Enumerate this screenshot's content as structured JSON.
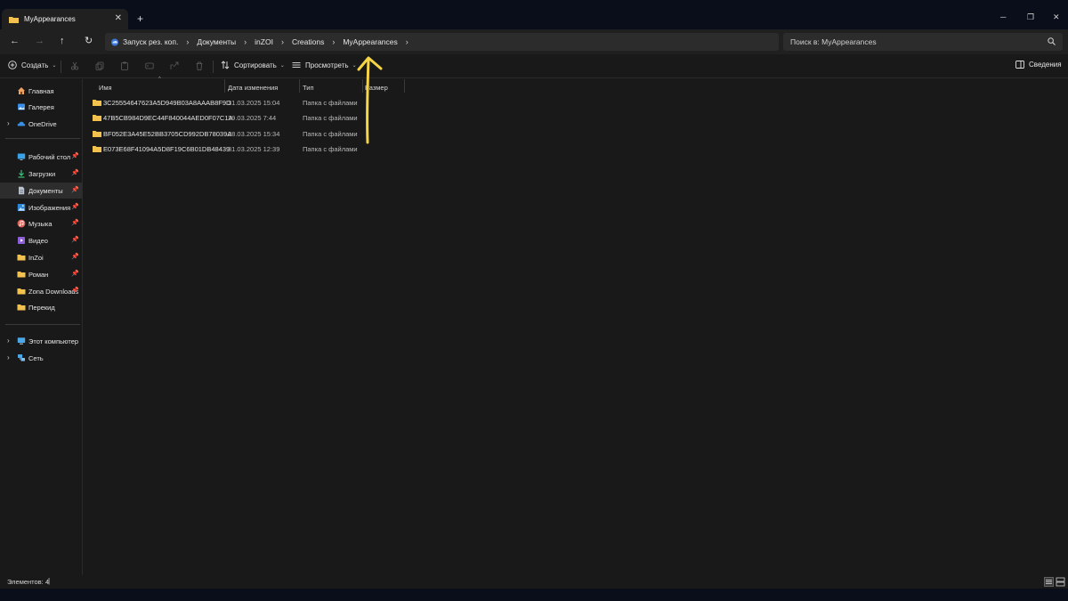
{
  "window": {
    "tab_title": "MyAppearances",
    "tab_close": "✕",
    "new_tab": "+",
    "minimize": "─",
    "maximize": "❐",
    "close": "✕"
  },
  "nav": {
    "back": "←",
    "forward": "→",
    "up": "↑",
    "refresh": "↻"
  },
  "breadcrumb": {
    "items": [
      "Запуск рез. коп.",
      "Документы",
      "inZOI",
      "Creations",
      "MyAppearances"
    ],
    "separator": "›"
  },
  "search": {
    "placeholder": "Поиск в: MyAppearances"
  },
  "toolbar": {
    "create_label": "Создать",
    "sort_label": "Сортировать",
    "view_label": "Просмотреть",
    "details_label": "Сведения",
    "caret": "⌄"
  },
  "sidebar": {
    "quick": [
      {
        "label": "Главная",
        "icon": "home-icon"
      },
      {
        "label": "Галерея",
        "icon": "gallery-icon"
      },
      {
        "label": "OneDrive",
        "icon": "cloud-icon"
      }
    ],
    "pinned": [
      {
        "label": "Рабочий стол",
        "icon": "desktop-icon",
        "pinned": true
      },
      {
        "label": "Загрузки",
        "icon": "downloads-icon",
        "pinned": true
      },
      {
        "label": "Документы",
        "icon": "documents-icon",
        "pinned": true,
        "selected": true
      },
      {
        "label": "Изображения",
        "icon": "pictures-icon",
        "pinned": true
      },
      {
        "label": "Музыка",
        "icon": "music-icon",
        "pinned": true
      },
      {
        "label": "Видео",
        "icon": "video-icon",
        "pinned": true
      },
      {
        "label": "InZoi",
        "icon": "folder-icon",
        "pinned": true
      },
      {
        "label": "Роман",
        "icon": "folder-icon",
        "pinned": true
      },
      {
        "label": "Zona Downloads",
        "icon": "folder-icon",
        "pinned": true
      },
      {
        "label": "Перекид",
        "icon": "folder-icon",
        "pinned": false
      }
    ],
    "devices": [
      {
        "label": "Этот компьютер",
        "icon": "computer-icon"
      },
      {
        "label": "Сеть",
        "icon": "network-icon"
      }
    ],
    "pin_glyph": "📌",
    "expand_glyph": "›"
  },
  "columns": {
    "name": "Имя",
    "date": "Дата изменения",
    "type": "Тип",
    "size": "Размер"
  },
  "files": [
    {
      "name": "3C25554647623A5D949B03A8AAAB8F9D",
      "date": "31.03.2025 15:04",
      "type": "Папка с файлами"
    },
    {
      "name": "47B5CB984D9EC44F840044AED0F07C1A",
      "date": "29.03.2025 7:44",
      "type": "Папка с файлами"
    },
    {
      "name": "BF052E3A45E52BB3705CD992DB78039A",
      "date": "28.03.2025 15:34",
      "type": "Папка с файлами"
    },
    {
      "name": "E073E68F41094A5D8F19C6B01DB48439",
      "date": "31.03.2025 12:39",
      "type": "Папка с файлами"
    }
  ],
  "status": {
    "items_count": "Элементов: 4",
    "cursor": "|"
  },
  "colors": {
    "folder_yellow": "#f2c14e",
    "annotation_arrow": "#f5d547",
    "background": "#191919",
    "titlebar": "#0a0e1a"
  }
}
